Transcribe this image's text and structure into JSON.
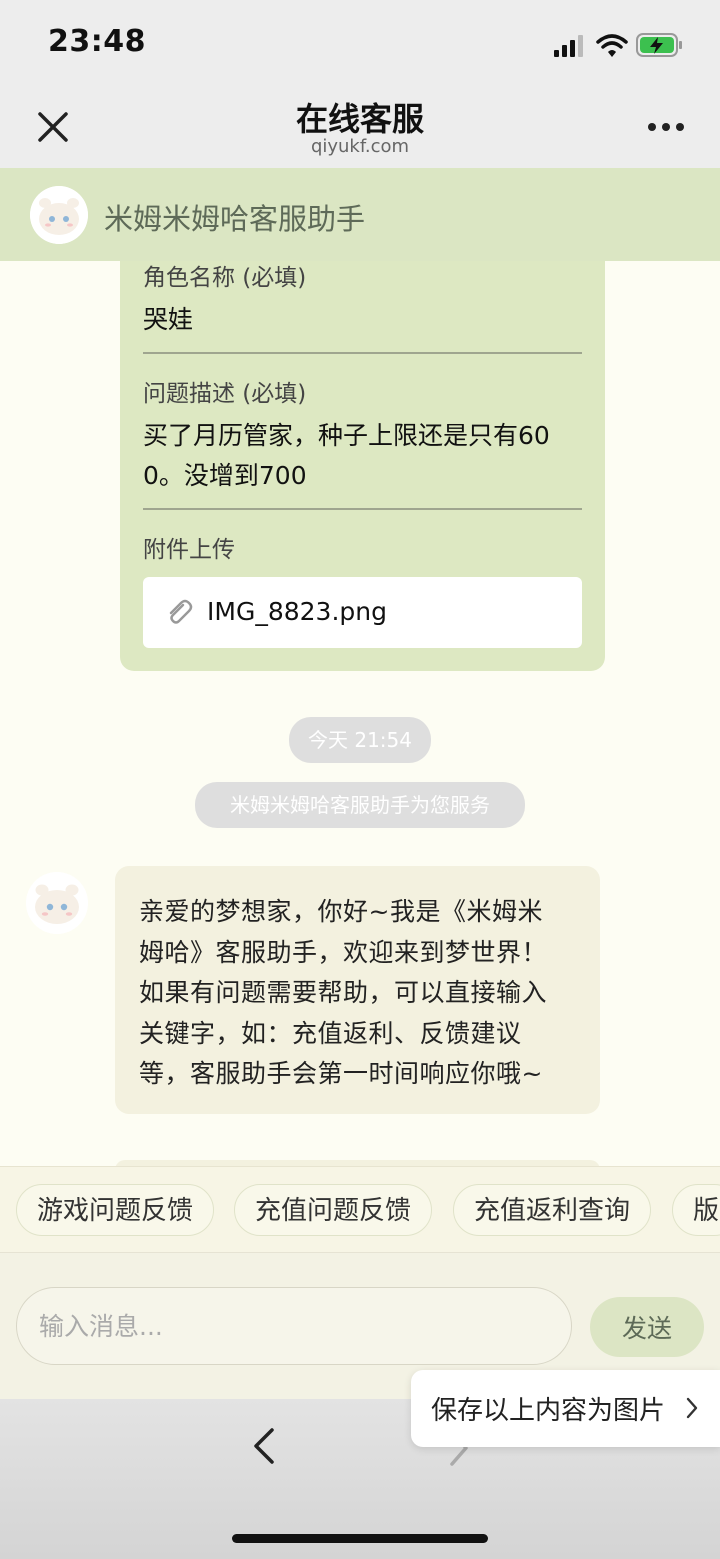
{
  "status_bar": {
    "time": "23:48"
  },
  "nav": {
    "title": "在线客服",
    "subtitle": "qiyukf.com"
  },
  "chat_header": {
    "name": "米姆米姆哈客服助手"
  },
  "form": {
    "role_label": "角色名称 (必填)",
    "role_value": "哭娃",
    "issue_label": "问题描述 (必填)",
    "issue_line1": "买了月历管家，种子上限还是只有60",
    "issue_line2": "0。没增到700",
    "attach_label": "附件上传",
    "attach_file": "IMG_8823.png"
  },
  "system": {
    "time": "今天 21:54",
    "service": "米姆米姆哈客服助手为您服务"
  },
  "greeting": {
    "lines": [
      "亲爱的梦想家，你好~我是《米姆米",
      "姆哈》客服助手，欢迎来到梦世界！",
      "如果有问题需要帮助，可以直接输入",
      "关键字，如：充值返利、反馈建议",
      "等，客服助手会第一时间响应你哦~"
    ]
  },
  "quick_replies": [
    "游戏问题反馈",
    "充值问题反馈",
    "充值返利查询",
    "版"
  ],
  "composer": {
    "placeholder": "输入消息...",
    "send_label": "发送"
  },
  "popup": {
    "save_label": "保存以上内容为图片"
  },
  "colors": {
    "accent_green": "#dde8c2",
    "header_green": "#dbe6c3",
    "bubble": "#f3f1df"
  }
}
